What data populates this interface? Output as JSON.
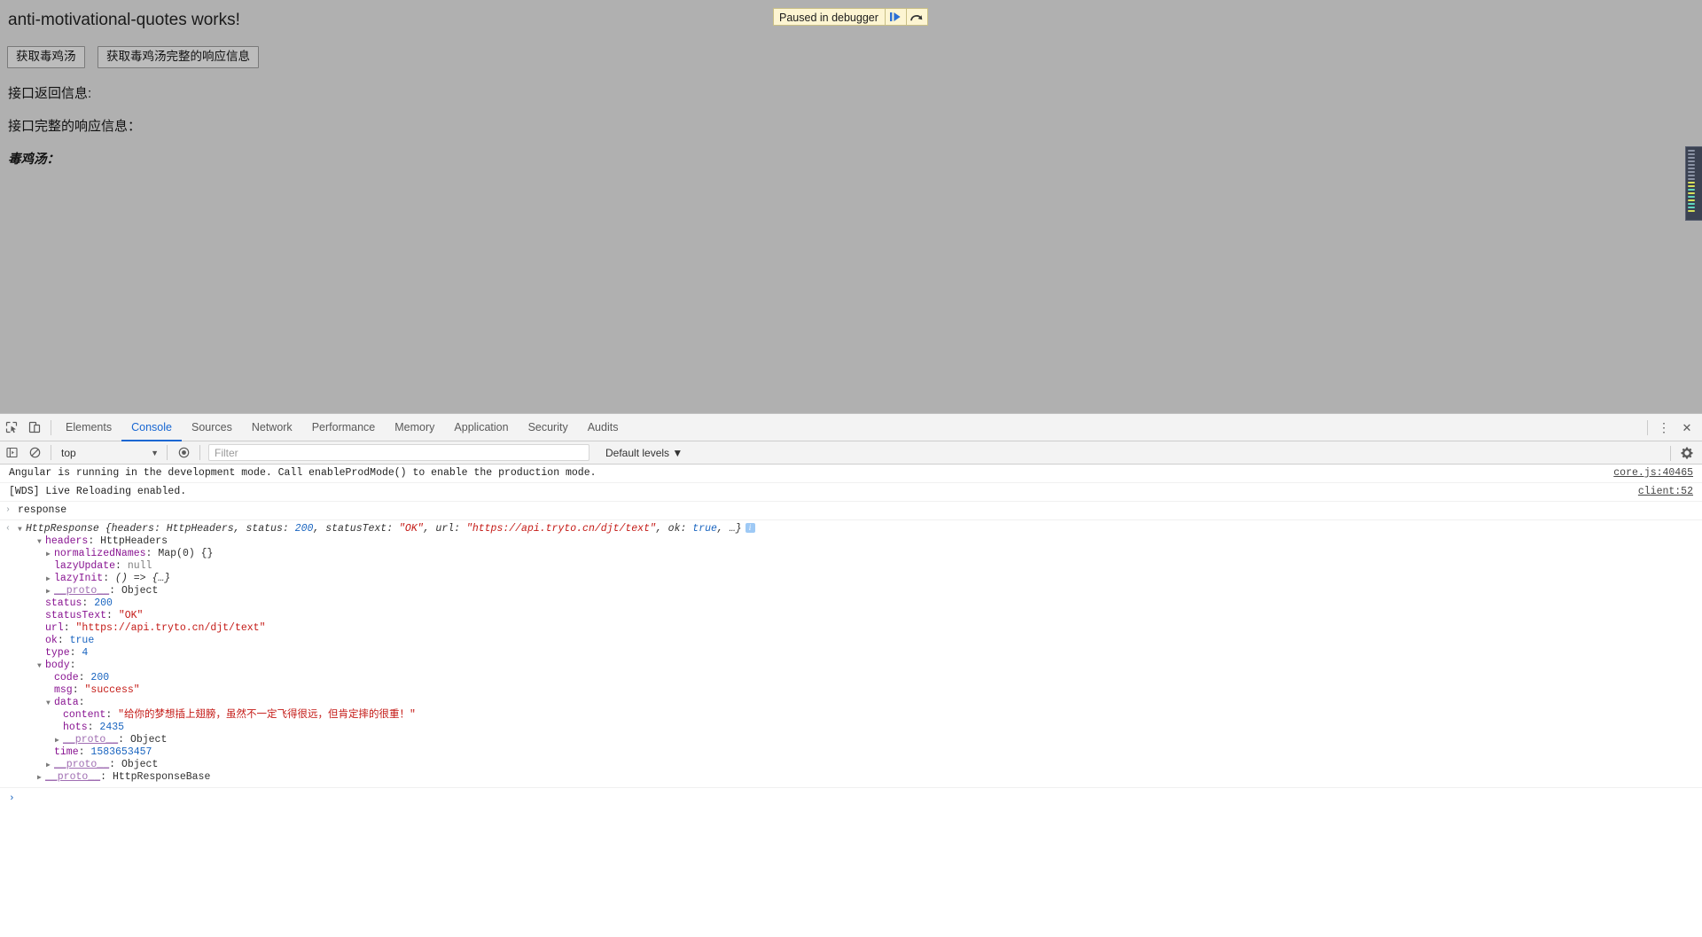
{
  "page": {
    "title": "anti-motivational-quotes works!",
    "buttons": [
      {
        "label": "获取毒鸡汤",
        "name": "fetch-quote-button"
      },
      {
        "label": "获取毒鸡汤完整的响应信息",
        "name": "fetch-full-response-button"
      }
    ],
    "lines": [
      "接口返回信息:",
      "接口完整的响应信息：",
      "毒鸡汤："
    ],
    "background_color": "#b0b0b0"
  },
  "paused_banner": {
    "text": "Paused in debugger",
    "resume_icon": "resume-script-icon",
    "step_over_icon": "step-over-icon",
    "background_color": "#fdf5d2",
    "border_color": "#c9bf86"
  },
  "devtools": {
    "left_icons": [
      {
        "name": "inspect-element-icon"
      },
      {
        "name": "toggle-device-toolbar-icon"
      }
    ],
    "tabs": [
      {
        "label": "Elements",
        "active": false
      },
      {
        "label": "Console",
        "active": true
      },
      {
        "label": "Sources",
        "active": false
      },
      {
        "label": "Network",
        "active": false
      },
      {
        "label": "Performance",
        "active": false
      },
      {
        "label": "Memory",
        "active": false
      },
      {
        "label": "Application",
        "active": false
      },
      {
        "label": "Security",
        "active": false
      },
      {
        "label": "Audits",
        "active": false
      }
    ],
    "active_tab_color": "#1967d2",
    "right_icons": [
      {
        "name": "more-options-icon",
        "glyph": "⋮"
      },
      {
        "name": "close-devtools-icon",
        "glyph": "✕"
      }
    ],
    "console_toolbar": {
      "sidebar_toggle_icon": "console-sidebar-icon",
      "clear_console_icon": "clear-console-icon",
      "context_selector": "top",
      "context_caret": "▼",
      "eye_icon": "live-expression-icon",
      "filter_placeholder": "Filter",
      "filter_value": "",
      "levels_label": "Default levels ▼",
      "settings_icon": "settings-gear-icon"
    }
  },
  "console": {
    "messages": [
      {
        "type": "log",
        "text": "Angular is running in the development mode. Call enableProdMode() to enable the production mode.",
        "source": "core.js:40465"
      },
      {
        "type": "log",
        "text": "[WDS] Live Reloading enabled.",
        "source": "client:52"
      },
      {
        "type": "input",
        "caret": "›",
        "text": "response"
      }
    ],
    "result": {
      "caret": "‹",
      "header": {
        "triangle": "▼",
        "class_name": "HttpResponse",
        "preview": " {headers: HttpHeaders, status: 200, statusText: \"OK\", url: \"https://api.tryto.cn/djt/text\", ok: true, …}",
        "preview_parts": [
          {
            "t": " {headers: HttpHeaders, status: ",
            "c": "plain"
          },
          {
            "t": "200",
            "c": "num"
          },
          {
            "t": ", statusText: ",
            "c": "plain"
          },
          {
            "t": "\"OK\"",
            "c": "str"
          },
          {
            "t": ", url: ",
            "c": "plain"
          },
          {
            "t": "\"https://api.tryto.cn/djt/text\"",
            "c": "str"
          },
          {
            "t": ", ok: ",
            "c": "plain"
          },
          {
            "t": "true",
            "c": "bool"
          },
          {
            "t": ", …}",
            "c": "plain"
          }
        ],
        "info_badge": "i"
      },
      "tree": [
        {
          "indent": 1,
          "tri": "▼",
          "key": "headers",
          "sep": ": ",
          "value": "HttpHeaders",
          "vclass": "plain",
          "kclass": "prop"
        },
        {
          "indent": 2,
          "tri": "▶",
          "key": "normalizedNames",
          "sep": ": ",
          "value": "Map(0) {}",
          "vclass": "plain",
          "kclass": "prop"
        },
        {
          "indent": 2,
          "tri": "",
          "key": "lazyUpdate",
          "sep": ": ",
          "value": "null",
          "vclass": "null",
          "kclass": "prop"
        },
        {
          "indent": 2,
          "tri": "▶",
          "key": "lazyInit",
          "sep": ": ",
          "value": "() => {…}",
          "vclass": "fn",
          "kclass": "prop"
        },
        {
          "indent": 2,
          "tri": "▶",
          "key": "__proto__",
          "sep": ": ",
          "value": "Object",
          "vclass": "plain",
          "kclass": "proto"
        },
        {
          "indent": 1,
          "tri": "",
          "key": "status",
          "sep": ": ",
          "value": "200",
          "vclass": "num",
          "kclass": "prop"
        },
        {
          "indent": 1,
          "tri": "",
          "key": "statusText",
          "sep": ": ",
          "value": "\"OK\"",
          "vclass": "str",
          "kclass": "prop"
        },
        {
          "indent": 1,
          "tri": "",
          "key": "url",
          "sep": ": ",
          "value": "\"https://api.tryto.cn/djt/text\"",
          "vclass": "str",
          "kclass": "prop"
        },
        {
          "indent": 1,
          "tri": "",
          "key": "ok",
          "sep": ": ",
          "value": "true",
          "vclass": "bool",
          "kclass": "prop"
        },
        {
          "indent": 1,
          "tri": "",
          "key": "type",
          "sep": ": ",
          "value": "4",
          "vclass": "num",
          "kclass": "prop"
        },
        {
          "indent": 1,
          "tri": "▼",
          "key": "body",
          "sep": ":",
          "value": "",
          "vclass": "plain",
          "kclass": "prop"
        },
        {
          "indent": 2,
          "tri": "",
          "key": "code",
          "sep": ": ",
          "value": "200",
          "vclass": "num",
          "kclass": "prop"
        },
        {
          "indent": 2,
          "tri": "",
          "key": "msg",
          "sep": ": ",
          "value": "\"success\"",
          "vclass": "str",
          "kclass": "prop"
        },
        {
          "indent": 2,
          "tri": "▼",
          "key": "data",
          "sep": ":",
          "value": "",
          "vclass": "plain",
          "kclass": "prop"
        },
        {
          "indent": 3,
          "tri": "",
          "key": "content",
          "sep": ": ",
          "value": "\"给你的梦想插上翅膀，虽然不一定飞得很远，但肯定摔的很重！\"",
          "vclass": "str",
          "kclass": "prop"
        },
        {
          "indent": 3,
          "tri": "",
          "key": "hots",
          "sep": ": ",
          "value": "2435",
          "vclass": "num",
          "kclass": "prop"
        },
        {
          "indent": 3,
          "tri": "▶",
          "key": "__proto__",
          "sep": ": ",
          "value": "Object",
          "vclass": "plain",
          "kclass": "proto"
        },
        {
          "indent": 2,
          "tri": "",
          "key": "time",
          "sep": ": ",
          "value": "1583653457",
          "vclass": "num",
          "kclass": "prop"
        },
        {
          "indent": 2,
          "tri": "▶",
          "key": "__proto__",
          "sep": ": ",
          "value": "Object",
          "vclass": "plain",
          "kclass": "proto"
        },
        {
          "indent": 1,
          "tri": "▶",
          "key": "__proto__",
          "sep": ": ",
          "value": "HttpResponseBase",
          "vclass": "plain",
          "kclass": "proto"
        }
      ]
    },
    "prompt_caret": "›"
  },
  "minimap": {
    "name": "code-minimap",
    "lines": [
      "#8b93a5",
      "#8b93a5",
      "#8b93a5",
      "#8b93a5",
      "#8b93a5",
      "#8b93a5",
      "#8b93a5",
      "#8b93a5",
      "#8b93a5",
      "#d8e05a",
      "#d8e05a",
      "#5fd6c0",
      "#d8e05a",
      "#5fd6c0",
      "#d8e05a",
      "#5fd6c0",
      "#5fd6c0",
      "#d8e05a"
    ]
  }
}
